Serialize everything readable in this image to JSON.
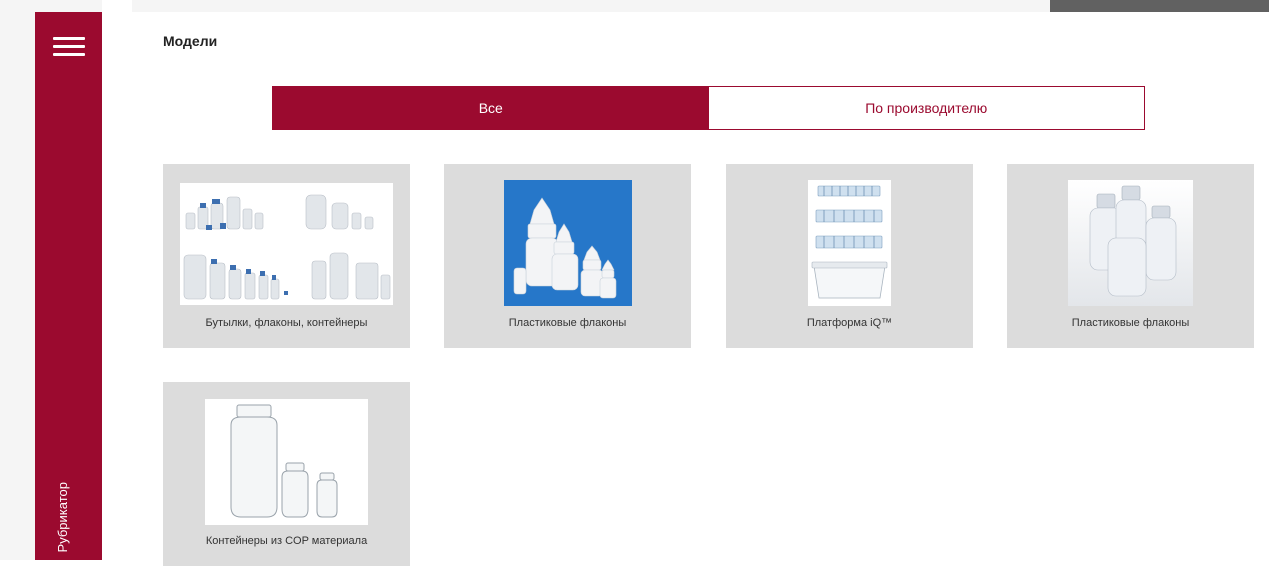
{
  "sidebar": {
    "label": "Рубрикатор"
  },
  "header": {
    "title": "Модели"
  },
  "filters": [
    {
      "label": "Все",
      "active": true
    },
    {
      "label": "По производителю",
      "active": false
    }
  ],
  "products": [
    {
      "name": "Бутылки, флаконы, контейнеры"
    },
    {
      "name": "Пластиковые флаконы"
    },
    {
      "name": "Платформа iQ™"
    },
    {
      "name": "Пластиковые флаконы"
    },
    {
      "name": "Контейнеры из COP материала"
    }
  ],
  "colors": {
    "accent": "#9b0a2f",
    "card_bg": "#dcdcdc"
  }
}
